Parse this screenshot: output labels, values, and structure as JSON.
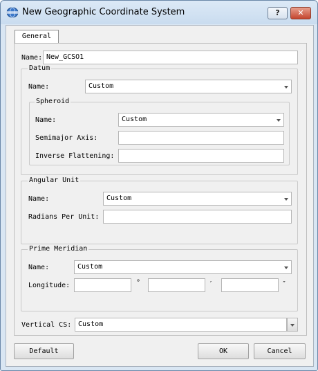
{
  "window": {
    "title": "New Geographic Coordinate System",
    "help_label": "?",
    "close_label": "✕"
  },
  "tabs": [
    {
      "label": "General"
    }
  ],
  "name": {
    "label": "Name:",
    "value": "New_GCSO1"
  },
  "datum": {
    "group_label": "Datum",
    "name_label": "Name:",
    "name_value": "Custom",
    "spheroid": {
      "group_label": "Spheroid",
      "name_label": "Name:",
      "name_value": "Custom",
      "semimajor_label": "Semimajor Axis:",
      "semimajor_value": "",
      "inverse_flattening_label": "Inverse Flattening:",
      "inverse_flattening_value": ""
    }
  },
  "angular_unit": {
    "group_label": "Angular Unit",
    "name_label": "Name:",
    "name_value": "Custom",
    "radians_label": "Radians Per Unit:",
    "radians_value": ""
  },
  "prime_meridian": {
    "group_label": "Prime Meridian",
    "name_label": "Name:",
    "name_value": "Custom",
    "longitude_label": "Longitude:",
    "degrees_value": "",
    "degrees_symbol": "°",
    "minutes_value": "",
    "minutes_symbol": "′",
    "seconds_value": "",
    "seconds_symbol": "″"
  },
  "vertical_cs": {
    "label": "Vertical CS:",
    "value": "Custom"
  },
  "buttons": {
    "default_label": "Default",
    "ok_label": "OK",
    "cancel_label": "Cancel"
  },
  "colors": {
    "title_bar": "#c9dcef",
    "close_button": "#c5452e",
    "dialog_bg": "#f0f0f0"
  }
}
